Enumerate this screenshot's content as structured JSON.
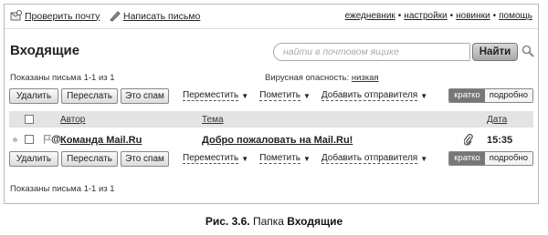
{
  "top": {
    "check_mail": "Проверить почту",
    "write_letter": "Написать письмо",
    "right_links": [
      "ежедневник",
      "настройки",
      "новинки",
      "помощь"
    ],
    "separator": "•"
  },
  "folder_title": "Входящие",
  "search": {
    "placeholder": "найти в почтовом ящике",
    "button": "Найти"
  },
  "status": {
    "shown": "Показаны письма 1-1 из 1",
    "virus_label": "Вирусная опасность:",
    "virus_value": "низкая"
  },
  "toolbar": {
    "delete": "Удалить",
    "forward": "Переслать",
    "spam": "Это спам",
    "move": "Переместить",
    "mark": "Пометить",
    "add_sender": "Добавить отправителя",
    "view_short": "кратко",
    "view_full": "подробно"
  },
  "columns": {
    "author": "Автор",
    "subject": "Тема",
    "date": "Дата"
  },
  "messages": [
    {
      "from": "Команда Mail.Ru",
      "subject": "Добро пожаловать на Mail.Ru!",
      "time": "15:35"
    }
  ],
  "caption": {
    "prefix": "Рис. 3.6.",
    "middle": "Папка",
    "bold": "Входящие"
  }
}
